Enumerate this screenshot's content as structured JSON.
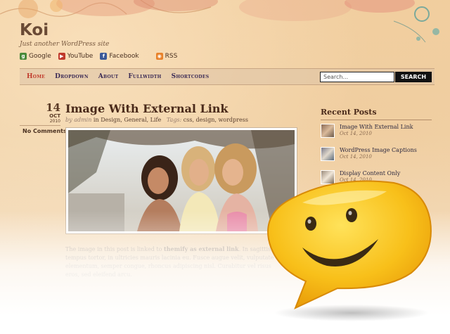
{
  "site": {
    "title": "Koi",
    "tagline": "Just another WordPress site"
  },
  "social": [
    {
      "label": "Google",
      "icon": "google-icon",
      "color": "#4a8a3a"
    },
    {
      "label": "YouTube",
      "icon": "youtube-icon",
      "color": "#c0392b"
    },
    {
      "label": "Facebook",
      "icon": "facebook-icon",
      "color": "#3b5998"
    },
    {
      "label": "RSS",
      "icon": "rss-icon",
      "color": "#e8822a"
    }
  ],
  "nav": {
    "items": [
      "Home",
      "Dropdown",
      "About",
      "Fullwidth",
      "Shortcodes"
    ],
    "active": "Home"
  },
  "search": {
    "placeholder": "Search...",
    "button_label": "SEARCH"
  },
  "post": {
    "day": "14",
    "month": "OCT",
    "year": "2010",
    "comments": "No Comments",
    "title": "Image With External Link",
    "meta_by": "by",
    "author": "admin",
    "meta_in": "in",
    "categories": "Design, General, Life",
    "tags_label": "Tags:",
    "tags": "css, design, wordpress",
    "excerpt_start": "The image in this post is linked to",
    "excerpt_bold": "themify as external link",
    "excerpt_rest": ". In sagittis tempus tortor, in ultricies mauris lacinia eu. Fusce augue velit, vulputate elementum, semper congue, rhoncus adipiscing nisl. Curabitur vel risus eros, sed eleifend arcu."
  },
  "sidebar": {
    "title": "Recent Posts",
    "items": [
      {
        "title": "Image With External Link",
        "date": "Oct 14, 2010"
      },
      {
        "title": "WordPress Image Captions",
        "date": "Oct 14, 2010"
      },
      {
        "title": "Display Content Only",
        "date": "Oct 14, 2010"
      }
    ]
  },
  "colors": {
    "accent_active": "#c0392b",
    "nav_text": "#3a2a55",
    "smiley_yellow": "#f5b800"
  }
}
